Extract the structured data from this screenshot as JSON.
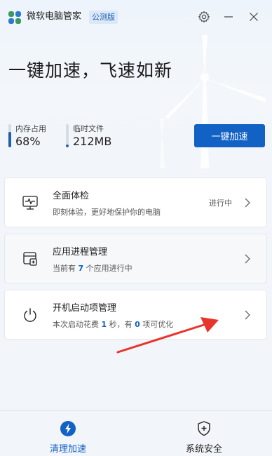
{
  "window": {
    "title": "微软电脑管家",
    "badge": "公测版"
  },
  "hero": {
    "headline": "一键加速，飞速如新",
    "stats": [
      {
        "label": "内存占用",
        "value": "68%",
        "level": 0.68
      },
      {
        "label": "临时文件",
        "value": "212MB",
        "level": 0.12
      }
    ],
    "boost_button": "一键加速"
  },
  "cards": [
    {
      "title": "全面体检",
      "desc": "即刻体验，更好地保护你的电脑",
      "status": "进行中",
      "icon": "monitor-pulse-icon"
    },
    {
      "title": "应用进程管理",
      "desc_prefix": "当前有 ",
      "desc_count": "7",
      "desc_suffix": " 个应用进行中",
      "icon": "app-window-icon"
    },
    {
      "title": "开机启动项管理",
      "desc_a": "本次启动花费 ",
      "desc_sec": "1",
      "desc_b": " 秒，有 ",
      "desc_opt": "0",
      "desc_c": " 项可优化",
      "icon": "power-icon"
    }
  ],
  "bottom_nav": [
    {
      "label": "清理加速",
      "active": true,
      "icon": "lightning-icon"
    },
    {
      "label": "系统安全",
      "active": false,
      "icon": "shield-plus-icon"
    }
  ],
  "colors": {
    "accent": "#1261c4",
    "annotation_arrow": "#e8352b"
  }
}
